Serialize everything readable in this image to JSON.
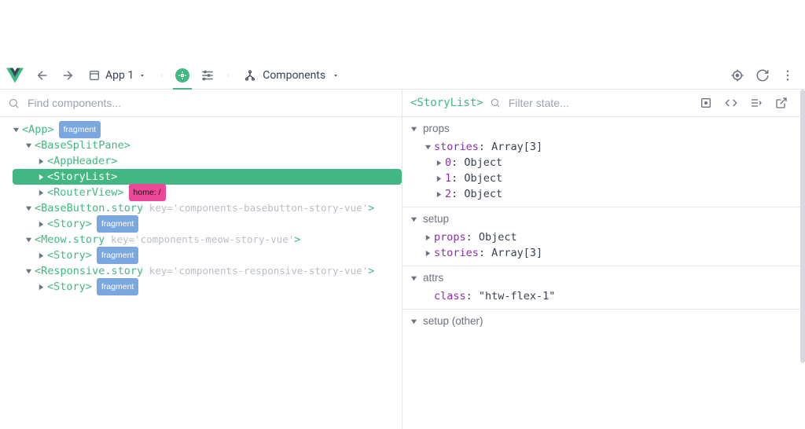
{
  "toolbar": {
    "app_label": "App 1",
    "section_label": "Components"
  },
  "left": {
    "search_placeholder": "Find components...",
    "tree": {
      "n0": {
        "open": "<App>",
        "badge": "fragment"
      },
      "n1": {
        "open": "<BaseSplitPane>"
      },
      "n2": {
        "open": "<AppHeader>"
      },
      "n3": {
        "open": "<StoryList>"
      },
      "n4": {
        "open": "<RouterView>",
        "badge": "home: /"
      },
      "n5": {
        "open": "<BaseButton.story",
        "key": "key=",
        "val": "'components-basebutton-story-vue'",
        "close": ">"
      },
      "n6": {
        "open": "<Story>",
        "badge": "fragment"
      },
      "n7": {
        "open": "<Meow.story",
        "key": "key=",
        "val": "'components-meow-story-vue'",
        "close": ">"
      },
      "n8": {
        "open": "<Story>",
        "badge": "fragment"
      },
      "n9": {
        "open": "<Responsive.story",
        "key": "key=",
        "val": "'components-responsive-story-vue'",
        "close": ">"
      },
      "n10": {
        "open": "<Story>",
        "badge": "fragment"
      }
    }
  },
  "right": {
    "title": "<StoryList>",
    "filter_placeholder": "Filter state...",
    "sections": {
      "props": {
        "label": "props",
        "root": {
          "k": "stories",
          "t": ": Array[3]"
        },
        "items": [
          {
            "k": "0",
            "t": ": Object"
          },
          {
            "k": "1",
            "t": ": Object"
          },
          {
            "k": "2",
            "t": ": Object"
          }
        ]
      },
      "setup": {
        "label": "setup",
        "items": [
          {
            "k": "props",
            "t": ": Object"
          },
          {
            "k": "stories",
            "t": ": Array[3]"
          }
        ]
      },
      "attrs": {
        "label": "attrs",
        "items": [
          {
            "k": "class",
            "t": ": \"htw-flex-1\""
          }
        ]
      },
      "setup_other": {
        "label": "setup (other)"
      }
    }
  }
}
